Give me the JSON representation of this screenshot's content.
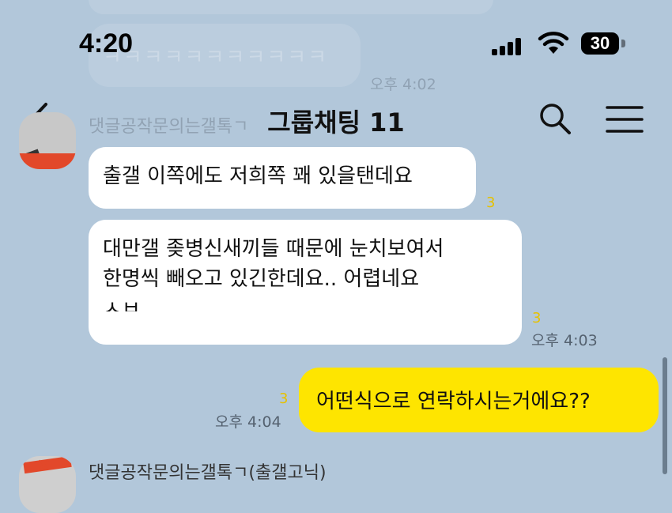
{
  "status_bar": {
    "time": "4:20",
    "battery": "30"
  },
  "header": {
    "title": "그룹채팅 11"
  },
  "background_ghost": {
    "laugh_text": "ㅋㅋㅋㅋㅋㅋㅋㅋㅋㅋㅋ",
    "time": "오후 4:02",
    "sender": "댓글공작문의는갤톡ㄱ"
  },
  "messages": [
    {
      "text": "출갤 이쪽에도 저희쪽 꽤 있을탠데요",
      "unread": "3"
    },
    {
      "lines": [
        "대만갤 좆병신새끼들 때문에 눈치보여서",
        "한명씩 빼오고 있긴한데요.. 어렵네요",
        "ㅅㅂ"
      ],
      "unread": "3",
      "time": "오후 4:03"
    },
    {
      "text": "어떤식으로 연락하시는거에요??",
      "unread": "3",
      "time": "오후 4:04",
      "mine": true
    }
  ],
  "next_sender": {
    "name": "댓글공작문의는갤톡ㄱ(출갤고닉)"
  },
  "colors": {
    "background": "#b2c7da",
    "my_bubble": "#fee500",
    "their_bubble": "#ffffff",
    "unread": "#e6c100"
  }
}
